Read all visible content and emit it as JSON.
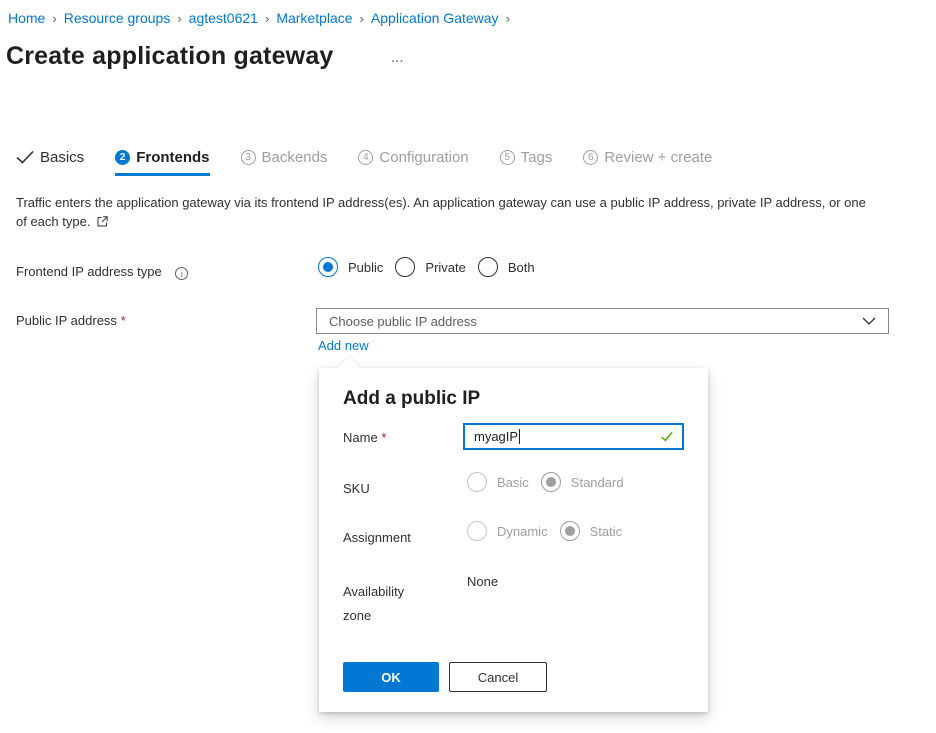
{
  "breadcrumb": [
    "Home",
    "Resource groups",
    "agtest0621",
    "Marketplace",
    "Application Gateway"
  ],
  "page": {
    "title": "Create application gateway",
    "more": "..."
  },
  "tabs": [
    {
      "label": "Basics",
      "state": "done"
    },
    {
      "num": "2",
      "label": "Frontends",
      "state": "active"
    },
    {
      "num": "3",
      "label": "Backends",
      "state": "disabled"
    },
    {
      "num": "4",
      "label": "Configuration",
      "state": "disabled"
    },
    {
      "num": "5",
      "label": "Tags",
      "state": "disabled"
    },
    {
      "num": "6",
      "label": "Review + create",
      "state": "disabled"
    }
  ],
  "description": "Traffic enters the application gateway via its frontend IP address(es). An application gateway can use a public IP address, private IP address, or one of each type.",
  "frontend_ip": {
    "label": "Frontend IP address type",
    "info": "i",
    "options": [
      "Public",
      "Private",
      "Both"
    ],
    "selected": "Public"
  },
  "public_ip": {
    "label": "Public IP address",
    "required": "*",
    "placeholder": "Choose public IP address",
    "add_new": "Add new"
  },
  "callout": {
    "title": "Add a public IP",
    "name_label": "Name",
    "name_required": "*",
    "name_value": "myagIP",
    "sku_label": "SKU",
    "sku_options": [
      "Basic",
      "Standard"
    ],
    "sku_selected": "Standard",
    "assignment_label": "Assignment",
    "assignment_options": [
      "Dynamic",
      "Static"
    ],
    "assignment_selected": "Static",
    "zone_label_1": "Availability",
    "zone_label_2": "zone",
    "zone_value": "None",
    "ok": "OK",
    "cancel": "Cancel"
  },
  "colors": {
    "accent": "#0078d4",
    "required": "#a4262c",
    "valid": "#57a300"
  }
}
